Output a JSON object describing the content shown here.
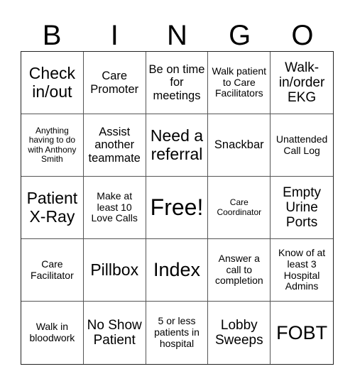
{
  "header": {
    "letters": [
      "B",
      "I",
      "N",
      "G",
      "O"
    ]
  },
  "board": {
    "rows": [
      [
        "Check in/out",
        "Care Promoter",
        "Be on time for meetings",
        "Walk patient to Care Facilitators",
        "Walk-in/order EKG"
      ],
      [
        "Anything having to do with Anthony Smith",
        "Assist another teammate",
        "Need a referral",
        "Snackbar",
        "Unattended Call Log"
      ],
      [
        "Patient X-Ray",
        "Make at least 10 Love Calls",
        "Free!",
        "Care Coordinator",
        "Empty Urine Ports"
      ],
      [
        "Care Facilitator",
        "Pillbox",
        "Index",
        "Answer a call to completion",
        "Know of at least 3 Hospital Admins"
      ],
      [
        "Walk in bloodwork",
        "No Show Patient",
        "5 or less patients in hospital",
        "Lobby Sweeps",
        "FOBT"
      ]
    ]
  }
}
